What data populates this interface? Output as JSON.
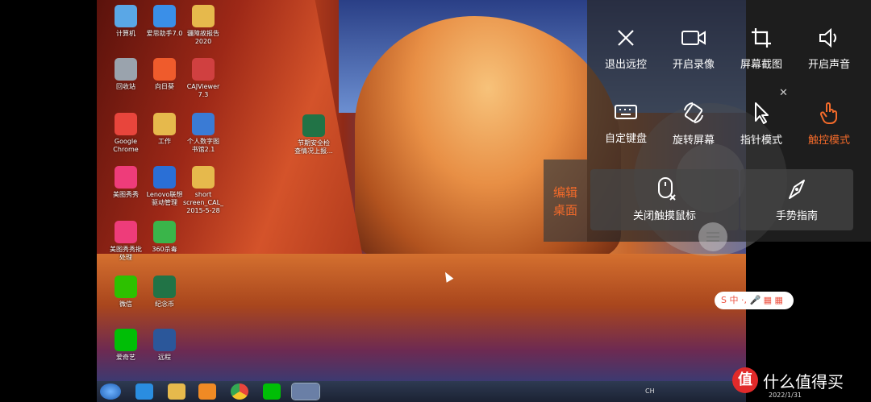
{
  "desktop": {
    "icons": [
      {
        "label": "计算机",
        "color": "#5aa7e6"
      },
      {
        "label": "爱思助手7.0",
        "color": "#3a8fe8"
      },
      {
        "label": "疆障故报告\n2020",
        "color": "#e6b94c"
      },
      {
        "label": "回收站",
        "color": "#9aa3ad"
      },
      {
        "label": "向日葵",
        "color": "#ef5b2c"
      },
      {
        "label": "CAJViewer\n7.3",
        "color": "#d04040"
      },
      {
        "label": "Google\nChrome",
        "color": "#e8453c"
      },
      {
        "label": "工作",
        "color": "#e6b94c"
      },
      {
        "label": "个人数字图\n书馆2.1",
        "color": "#3a7bd5"
      },
      {
        "label": "美图秀秀",
        "color": "#ee3c7a"
      },
      {
        "label": "Lenovo联想\n驱动管理",
        "color": "#2a6fd6"
      },
      {
        "label": "short\nscreen_CAL_\n2015-5-28",
        "color": "#e6b94c"
      },
      {
        "label": "美图秀秀批\n处理",
        "color": "#ee3c7a"
      },
      {
        "label": "360杀毒",
        "color": "#3ab54a"
      },
      {
        "label": "微信",
        "color": "#2dc100"
      },
      {
        "label": "纪念币",
        "color": "#217346"
      },
      {
        "label": "爱奇艺",
        "color": "#00be06"
      },
      {
        "label": "远程",
        "color": "#2b579a"
      }
    ],
    "file_icon": {
      "label": "节期安全检\n查情况上报...",
      "color": "#217346"
    }
  },
  "taskbar": {
    "items": [
      "start",
      "ie",
      "explorer",
      "media",
      "chrome",
      "iqiyi",
      "remote"
    ],
    "tray_lang": "CH",
    "date": "2022/1/31"
  },
  "menu": {
    "row1": [
      "退出远控",
      "开启录像",
      "屏幕截图",
      "开启声音"
    ],
    "row2": [
      "自定键盘",
      "旋转屏幕",
      "指针模式",
      "触控模式"
    ],
    "cards": [
      "关闭触摸鼠标",
      "手势指南"
    ],
    "edit_desktop": "编辑\n桌面",
    "accent": "#f26a2a"
  },
  "sogou": {
    "text": "S 中 ·, 🎤 ▦ ▦"
  },
  "watermark": {
    "text": "什么值得买",
    "logo": "值"
  }
}
